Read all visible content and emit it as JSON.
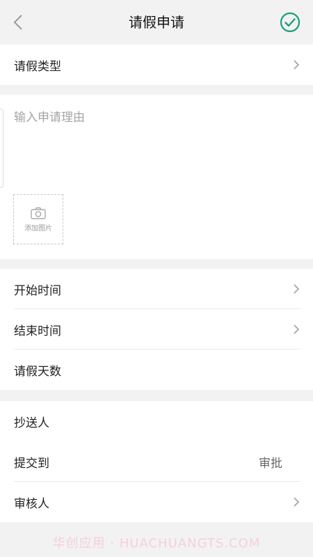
{
  "header": {
    "title": "请假申请"
  },
  "leave_type": {
    "label": "请假类型"
  },
  "reason": {
    "placeholder": "输入申请理由",
    "add_image_label": "添加图片"
  },
  "time": {
    "start_label": "开始时间",
    "end_label": "结束时间",
    "days_label": "请假天数"
  },
  "people": {
    "cc_label": "抄送人",
    "submit_to_label": "提交到",
    "submit_to_value": "审批",
    "reviewer_label": "审核人"
  },
  "watermark": "华创应用 · HUACHUANGTS.COM",
  "colors": {
    "accent": "#1a9e7d",
    "background": "#f2f2f2"
  }
}
